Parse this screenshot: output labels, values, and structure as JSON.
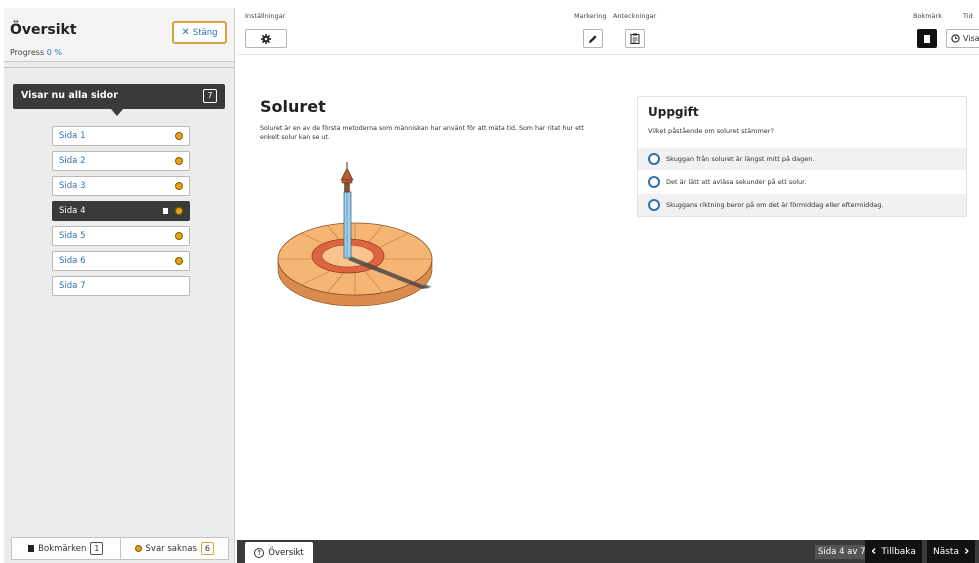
{
  "sidebar": {
    "title": "Översikt",
    "progress_label": "Progress",
    "progress_value": "0 %",
    "close_label": "Stäng",
    "showing_label": "Visar nu alla sidor",
    "showing_count": "7",
    "pages": [
      {
        "label": "Sida 1",
        "answer_missing": true,
        "bookmarked": false,
        "active": false
      },
      {
        "label": "Sida 2",
        "answer_missing": true,
        "bookmarked": false,
        "active": false
      },
      {
        "label": "Sida 3",
        "answer_missing": true,
        "bookmarked": false,
        "active": false
      },
      {
        "label": "Sida 4",
        "answer_missing": true,
        "bookmarked": true,
        "active": true
      },
      {
        "label": "Sida 5",
        "answer_missing": true,
        "bookmarked": false,
        "active": false
      },
      {
        "label": "Sida 6",
        "answer_missing": true,
        "bookmarked": false,
        "active": false
      },
      {
        "label": "Sida 7",
        "answer_missing": false,
        "bookmarked": false,
        "active": false
      }
    ],
    "footer": {
      "bookmarks_label": "Bokmärken",
      "bookmarks_count": "1",
      "missing_label": "Svar saknas",
      "missing_count": "6"
    }
  },
  "toolbar": {
    "settings_label": "Inställningar",
    "marking_label": "Markering",
    "notes_label": "Anteckningar",
    "bookmark_label": "Bokmärk",
    "time_label": "Tid",
    "time_button": "Visa"
  },
  "content": {
    "title": "Soluret",
    "text": "Soluret är en av de första metoderna som människan har använt för att mäta tid. Som har ritat hur ett enkelt solur kan se ut."
  },
  "task": {
    "title": "Uppgift",
    "question": "Vilket påstående om soluret stämmer?",
    "options": [
      "Skuggan från soluret är längst mitt på dagen.",
      "Det är lätt att avläsa sekunder på ett solur.",
      "Skuggans riktning beror på om det är förmiddag eller eftermiddag."
    ]
  },
  "bottom": {
    "overview_label": "Översikt",
    "page_info": "Sida 4 av 7",
    "back_label": "Tillbaka",
    "next_label": "Nästa"
  },
  "colors": {
    "accent_blue": "#2f6fb0",
    "dark_bar": "#3a3a3a",
    "warning_orange": "#e3a11a",
    "close_border": "#d9a23a"
  }
}
